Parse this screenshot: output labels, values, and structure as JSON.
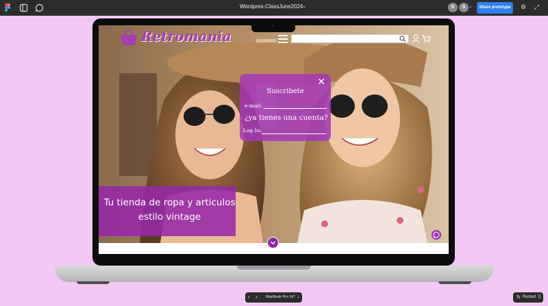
{
  "toolbar": {
    "document_title": "Wordpres-ClassJune2024",
    "avatars": [
      "S",
      "S"
    ],
    "share_label": "Share prototype"
  },
  "site": {
    "logo_text": "Retromania",
    "search_placeholder": "",
    "popup": {
      "title": "Suscribete",
      "email_label": "e-mail:",
      "account_question": "¿ya tienes una cuenta?",
      "login_label": "Log In:"
    },
    "banner": {
      "line1": "Tu tienda de ropa y articulos",
      "line2": "estilo vintage"
    }
  },
  "bottom": {
    "device_label": "MacBook Pro 14\"",
    "restart_label": "Restart"
  },
  "colors": {
    "canvas": "#f3c8f5",
    "brand_purple": "#a43fb0",
    "share_blue": "#2f80ed"
  }
}
